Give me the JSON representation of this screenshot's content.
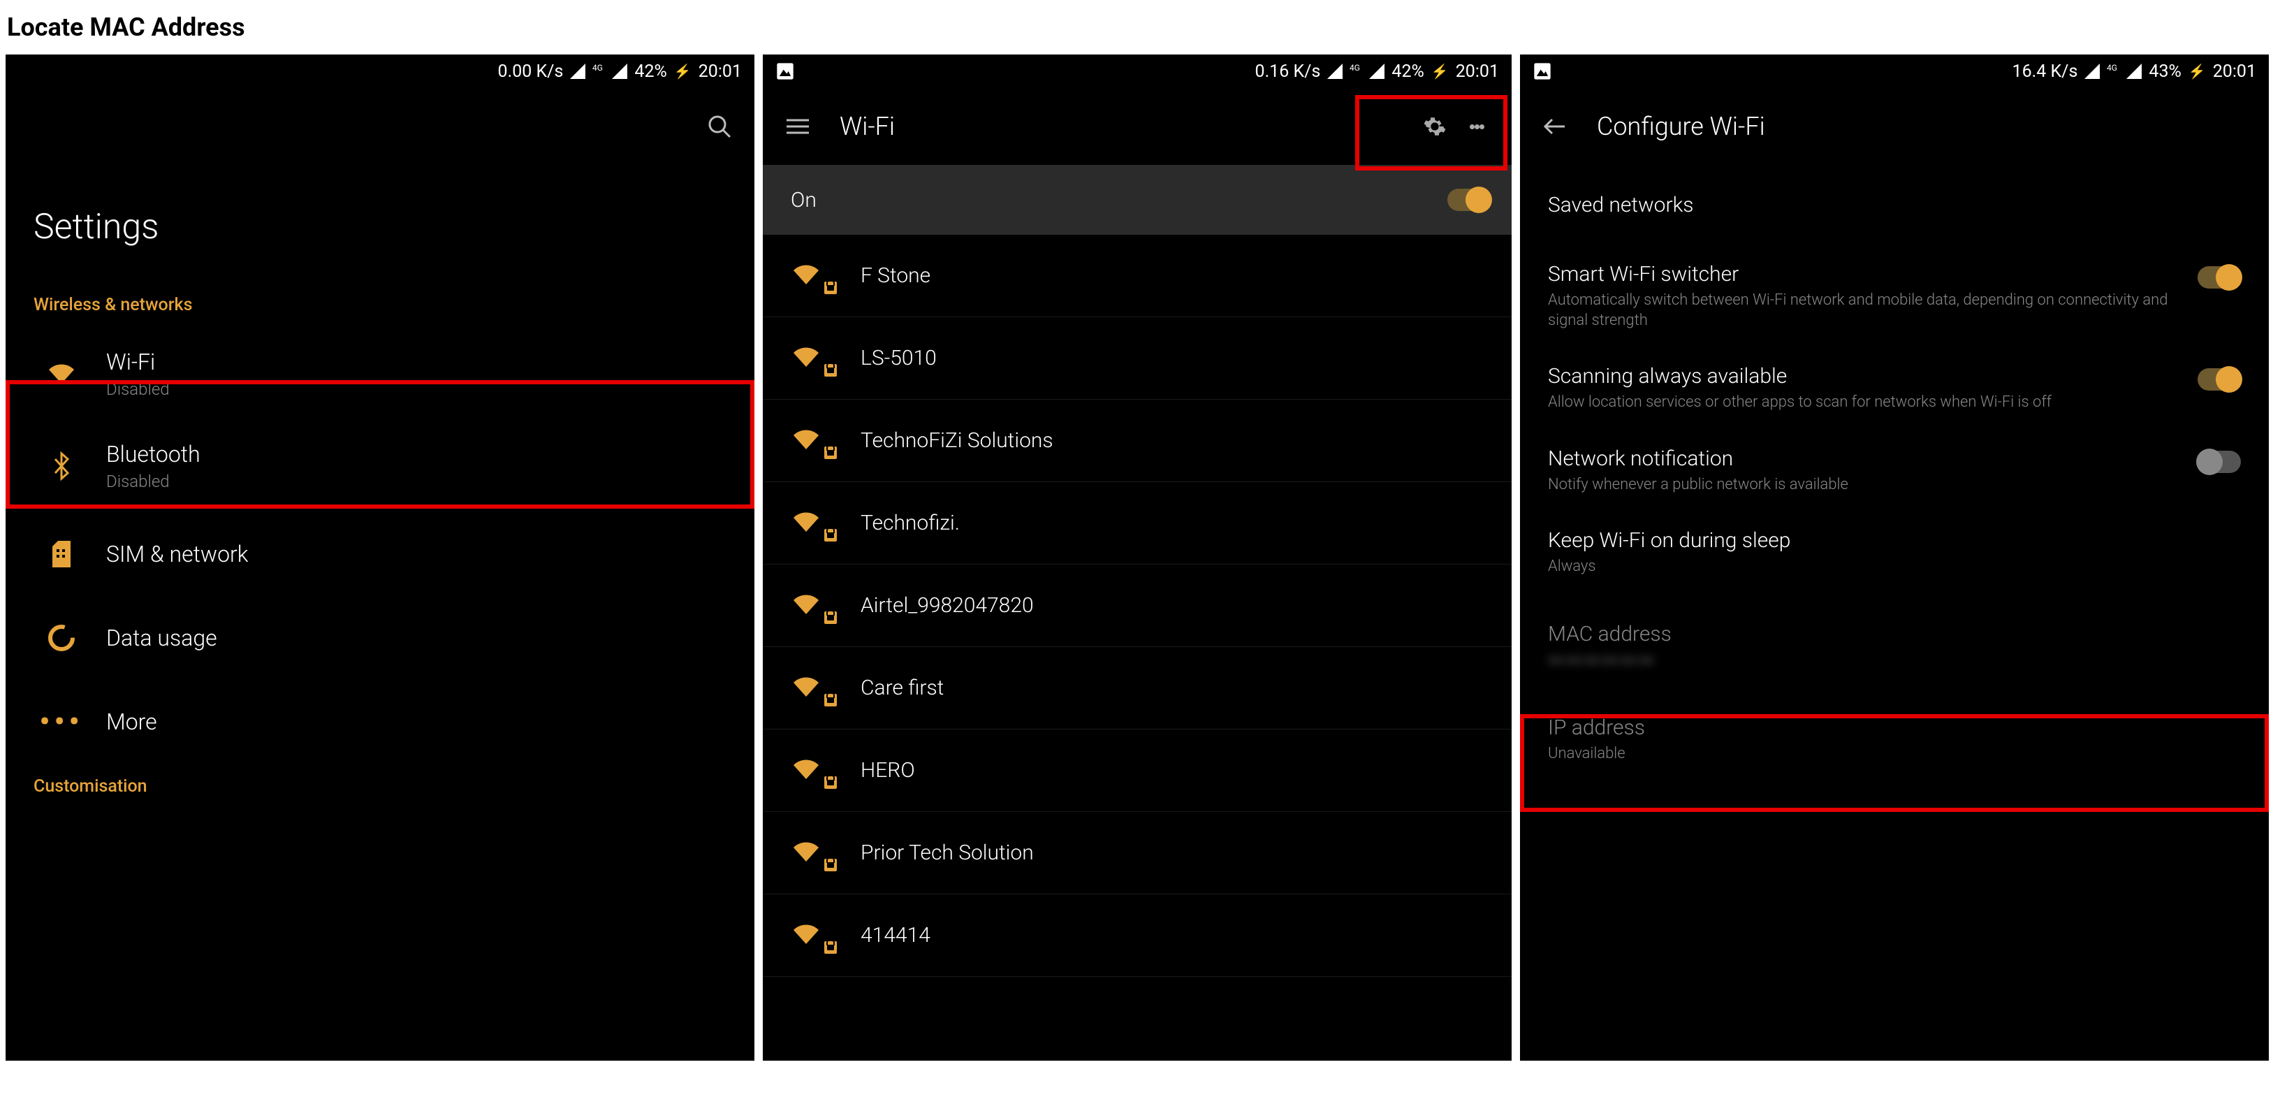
{
  "page_title": "Locate MAC Address",
  "status": {
    "s1": {
      "speed": "0.00 K/s",
      "net": "4G",
      "battery": "42%",
      "time": "20:01"
    },
    "s2": {
      "speed": "0.16 K/s",
      "net": "4G",
      "battery": "42%",
      "time": "20:01"
    },
    "s3": {
      "speed": "16.4 K/s",
      "net": "4G",
      "battery": "43%",
      "time": "20:01"
    }
  },
  "screen1": {
    "title": "Settings",
    "section1": "Wireless & networks",
    "wifi": {
      "label": "Wi-Fi",
      "status": "Disabled"
    },
    "bluetooth": {
      "label": "Bluetooth",
      "status": "Disabled"
    },
    "sim": {
      "label": "SIM & network"
    },
    "data": {
      "label": "Data usage"
    },
    "more": {
      "label": "More"
    },
    "section2": "Customisation"
  },
  "screen2": {
    "title": "Wi-Fi",
    "toggle_label": "On",
    "networks": [
      "F Stone",
      "LS-5010",
      "TechnoFiZi Solutions",
      "Technofizi.",
      "Airtel_9982047820",
      "Care first",
      "HERO",
      "Prior Tech Solution",
      "414414"
    ]
  },
  "screen3": {
    "title": "Configure Wi-Fi",
    "saved": "Saved networks",
    "smart": {
      "title": "Smart Wi-Fi switcher",
      "desc": "Automatically switch between Wi-Fi network and mobile data, depending on connectivity and signal strength"
    },
    "scan": {
      "title": "Scanning always available",
      "desc": "Allow location services or other apps to scan for networks when Wi-Fi is off"
    },
    "notif": {
      "title": "Network notification",
      "desc": "Notify whenever a public network is available"
    },
    "keep": {
      "title": "Keep Wi-Fi on during sleep",
      "value": "Always"
    },
    "mac": {
      "title": "MAC address",
      "value": "xx:xx:xx:xx:xx:xx"
    },
    "ip": {
      "title": "IP address",
      "value": "Unavailable"
    }
  }
}
